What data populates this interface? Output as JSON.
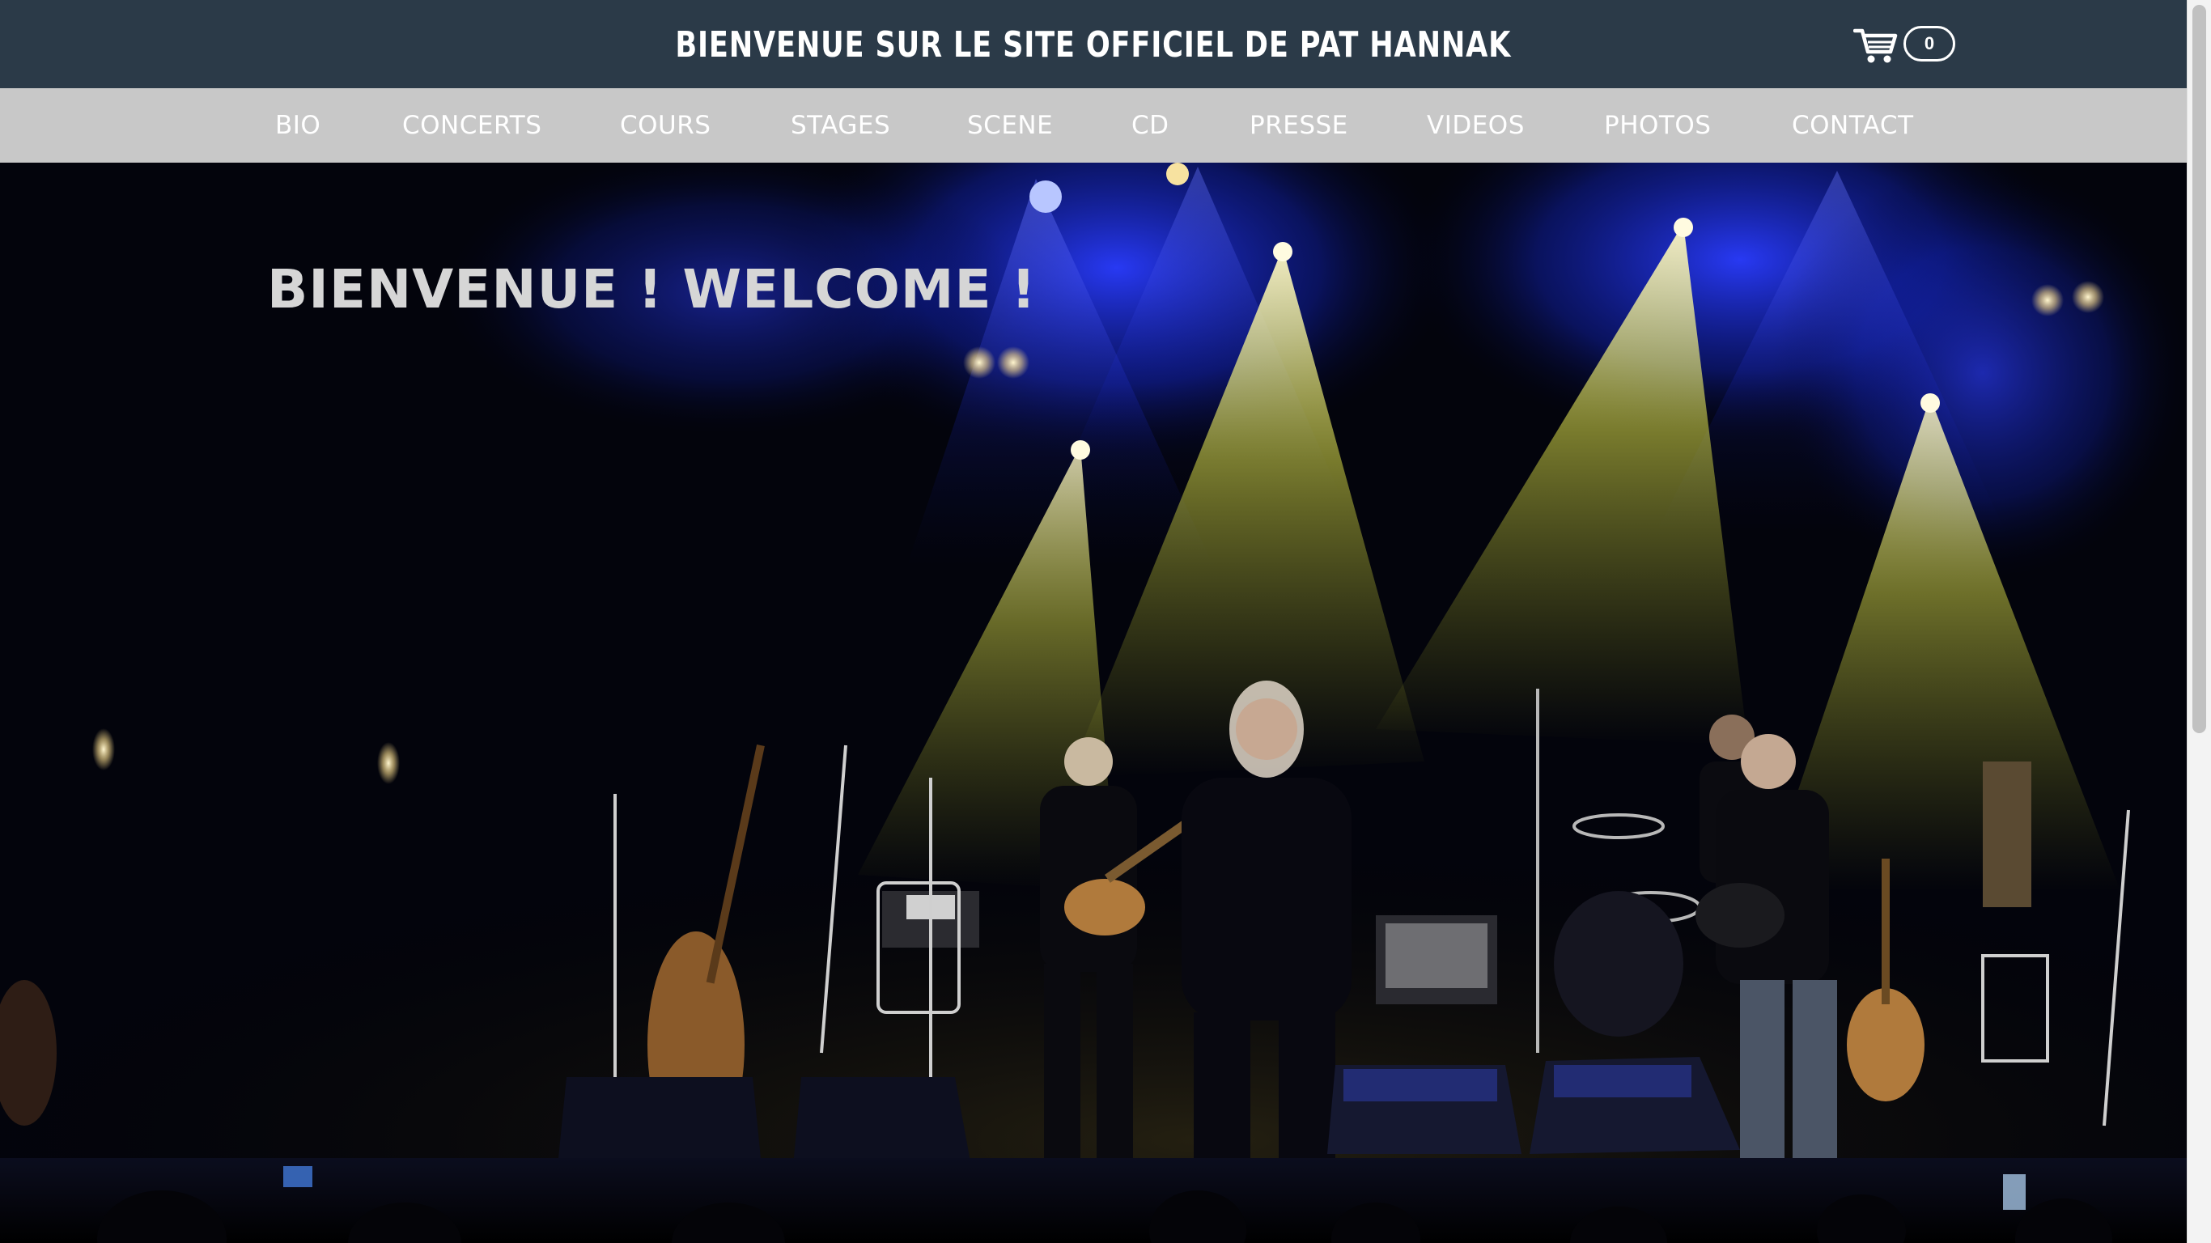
{
  "header": {
    "site_title": "BIENVENUE SUR LE SITE OFFICIEL DE PAT HANNAK",
    "cart": {
      "icon": "shopping-cart-icon",
      "count": "0"
    }
  },
  "nav": {
    "items": [
      {
        "label": "BIO"
      },
      {
        "label": "CONCERTS"
      },
      {
        "label": "COURS"
      },
      {
        "label": "STAGES"
      },
      {
        "label": "SCENE"
      },
      {
        "label": "CD"
      },
      {
        "label": "PRESSE"
      },
      {
        "label": "VIDEOS"
      },
      {
        "label": "PHOTOS"
      },
      {
        "label": "CONTACT"
      }
    ]
  },
  "hero": {
    "heading": "BIENVENUE ! WELCOME !",
    "image": "concert-stage-photo"
  },
  "colors": {
    "header_bg": "#2b3a48",
    "nav_bg": "#c8c8c8",
    "nav_text": "#ffffff",
    "heading_text": "#d6d6d6"
  }
}
